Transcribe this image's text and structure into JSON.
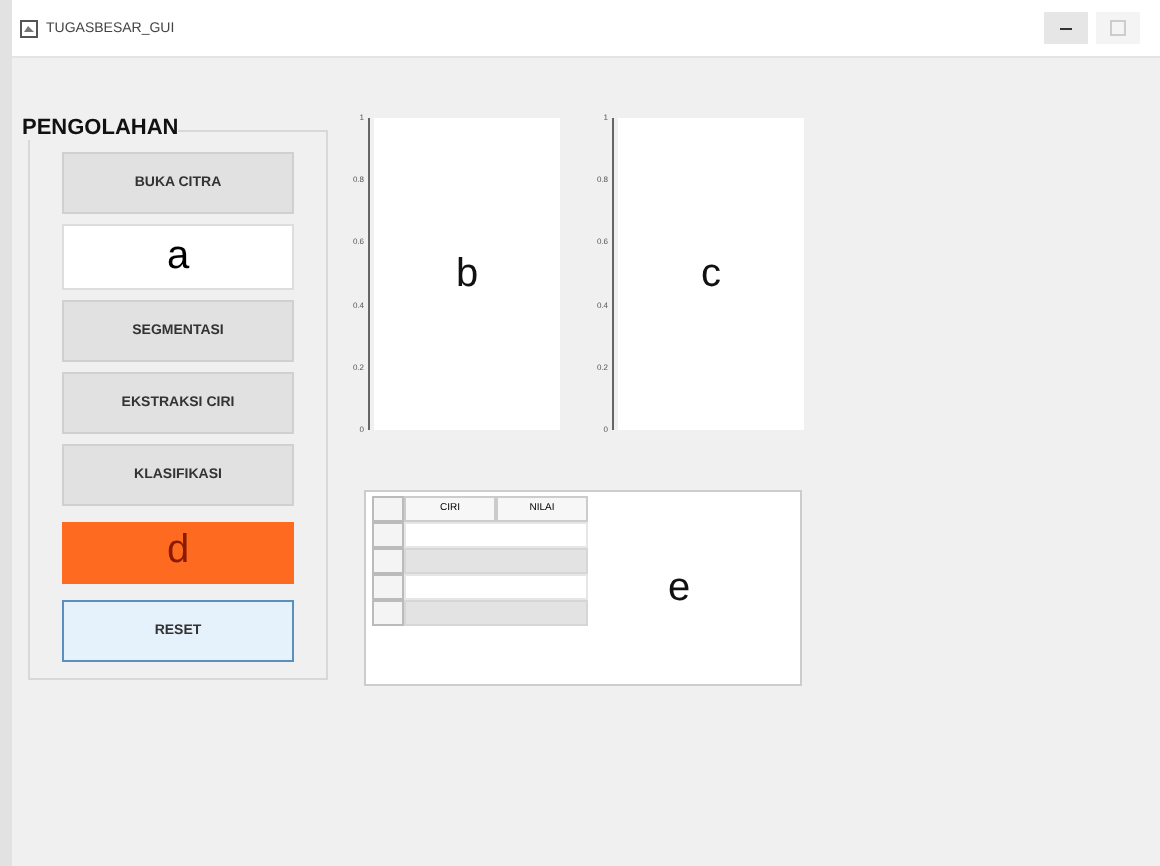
{
  "window": {
    "title": "TUGASBESAR_GUI"
  },
  "panel": {
    "title": "PENGOLAHAN",
    "items": [
      {
        "kind": "button",
        "label": "BUKA CITRA",
        "focused": false
      },
      {
        "kind": "field",
        "label": "a"
      },
      {
        "kind": "button",
        "label": "SEGMENTASI",
        "focused": false
      },
      {
        "kind": "button",
        "label": "EKSTRAKSI CIRI",
        "focused": false
      },
      {
        "kind": "button",
        "label": "KLASIFIKASI",
        "focused": false
      },
      {
        "kind": "indicator",
        "label": "d",
        "color": "#ff6a21"
      },
      {
        "kind": "button",
        "label": "RESET",
        "focused": true
      }
    ]
  },
  "axes": [
    {
      "label": "b",
      "yticks": [
        "1",
        "0.8",
        "0.6",
        "0.4",
        "0.2",
        "0"
      ]
    },
    {
      "label": "c",
      "yticks": [
        "1",
        "0.8",
        "0.6",
        "0.4",
        "0.2",
        "0"
      ]
    }
  ],
  "table_panel": {
    "label": "e",
    "columns": [
      "CIRI",
      "NILAI"
    ],
    "rows": [
      {
        "striped": false
      },
      {
        "striped": true
      },
      {
        "striped": false
      },
      {
        "striped": true
      }
    ]
  }
}
